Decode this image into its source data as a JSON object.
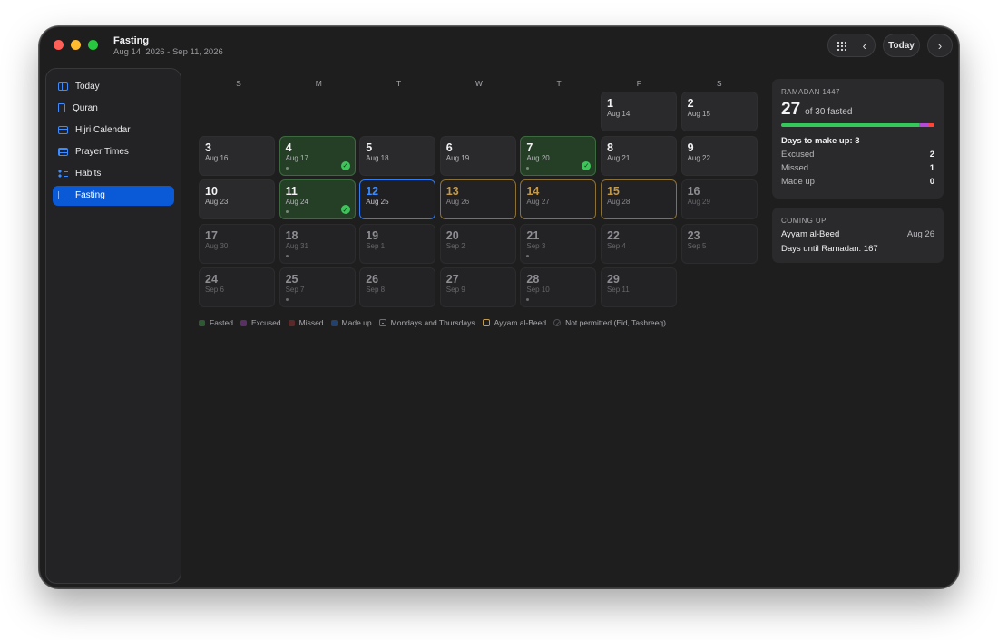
{
  "window": {
    "title": "Fasting",
    "subtitle": "Aug 14, 2026 - Sep 11, 2026"
  },
  "toolbar": {
    "today_label": "Today",
    "grid_icon": "grid-icon",
    "prev_icon": "chevron-left-icon",
    "next_icon": "chevron-right-icon"
  },
  "sidebar": {
    "items": [
      {
        "label": "Today",
        "icon": "today-icon"
      },
      {
        "label": "Quran",
        "icon": "book-icon"
      },
      {
        "label": "Hijri Calendar",
        "icon": "calendar-icon"
      },
      {
        "label": "Prayer Times",
        "icon": "table-icon"
      },
      {
        "label": "Habits",
        "icon": "list-icon"
      },
      {
        "label": "Fasting",
        "icon": "chart-icon",
        "active": true
      }
    ]
  },
  "weekdays": [
    "S",
    "M",
    "T",
    "W",
    "T",
    "F",
    "S"
  ],
  "calendar": {
    "cells": [
      null,
      null,
      null,
      null,
      null,
      {
        "day": "1",
        "greg": "Aug 14"
      },
      {
        "day": "2",
        "greg": "Aug 15"
      },
      {
        "day": "3",
        "greg": "Aug 16"
      },
      {
        "day": "4",
        "greg": "Aug 17",
        "status": "fasted",
        "dot": true,
        "check": true
      },
      {
        "day": "5",
        "greg": "Aug 18"
      },
      {
        "day": "6",
        "greg": "Aug 19"
      },
      {
        "day": "7",
        "greg": "Aug 20",
        "status": "fasted",
        "dot": true,
        "check": true
      },
      {
        "day": "8",
        "greg": "Aug 21"
      },
      {
        "day": "9",
        "greg": "Aug 22"
      },
      {
        "day": "10",
        "greg": "Aug 23"
      },
      {
        "day": "11",
        "greg": "Aug 24",
        "status": "fasted",
        "dot": true,
        "check": true
      },
      {
        "day": "12",
        "greg": "Aug 25",
        "status": "today"
      },
      {
        "day": "13",
        "greg": "Aug 26",
        "status": "beed"
      },
      {
        "day": "14",
        "greg": "Aug 27",
        "status": "beed"
      },
      {
        "day": "15",
        "greg": "Aug 28",
        "status": "beed"
      },
      {
        "day": "16",
        "greg": "Aug 29",
        "status": "future"
      },
      {
        "day": "17",
        "greg": "Aug 30",
        "status": "future"
      },
      {
        "day": "18",
        "greg": "Aug 31",
        "status": "future",
        "dot": true
      },
      {
        "day": "19",
        "greg": "Sep 1",
        "status": "future"
      },
      {
        "day": "20",
        "greg": "Sep 2",
        "status": "future"
      },
      {
        "day": "21",
        "greg": "Sep 3",
        "status": "future",
        "dot": true
      },
      {
        "day": "22",
        "greg": "Sep 4",
        "status": "future"
      },
      {
        "day": "23",
        "greg": "Sep 5",
        "status": "future"
      },
      {
        "day": "24",
        "greg": "Sep 6",
        "status": "future"
      },
      {
        "day": "25",
        "greg": "Sep 7",
        "status": "future",
        "dot": true
      },
      {
        "day": "26",
        "greg": "Sep 8",
        "status": "future"
      },
      {
        "day": "27",
        "greg": "Sep 9",
        "status": "future"
      },
      {
        "day": "28",
        "greg": "Sep 10",
        "status": "future",
        "dot": true
      },
      {
        "day": "29",
        "greg": "Sep 11",
        "status": "future"
      }
    ]
  },
  "legend": [
    {
      "label": "Fasted",
      "kind": "fill",
      "color": "#2d5a33"
    },
    {
      "label": "Excused",
      "kind": "fill",
      "color": "#5a2f63"
    },
    {
      "label": "Missed",
      "kind": "fill",
      "color": "#5a2a2a"
    },
    {
      "label": "Made up",
      "kind": "fill",
      "color": "#22416b"
    },
    {
      "label": "Mondays and Thursdays",
      "kind": "dot"
    },
    {
      "label": "Ayyam al-Beed",
      "kind": "gold"
    },
    {
      "label": "Not permitted (Eid, Tashreeq)",
      "kind": "np"
    }
  ],
  "ramadan": {
    "heading": "RAMADAN 1447",
    "fasted_count": "27",
    "fasted_suffix": "of 30 fasted",
    "progress": {
      "fasted": 27,
      "excused": 2,
      "missed": 1,
      "total": 30
    },
    "makeup_title": "Days to make up: 3",
    "stats": [
      {
        "label": "Excused",
        "value": "2"
      },
      {
        "label": "Missed",
        "value": "1"
      },
      {
        "label": "Made up",
        "value": "0"
      }
    ]
  },
  "coming_up": {
    "heading": "COMING UP",
    "event": "Ayyam al-Beed",
    "event_date": "Aug 26",
    "until": "Days until Ramadan: 167"
  }
}
